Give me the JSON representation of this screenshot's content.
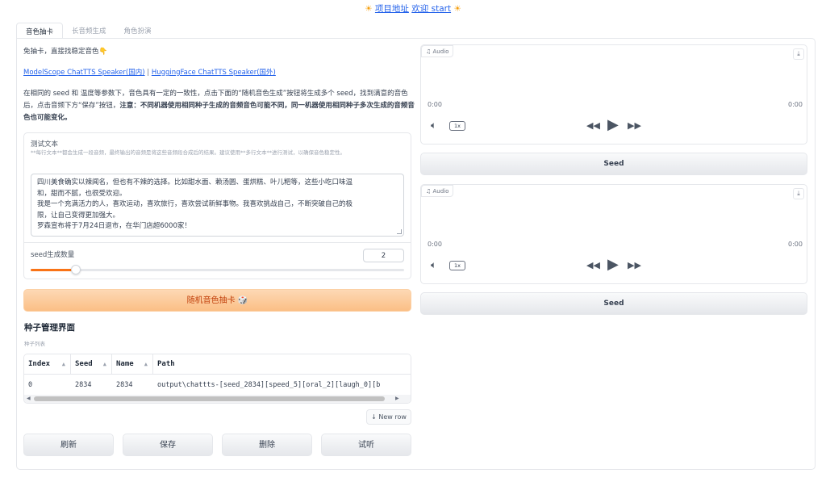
{
  "header": {
    "left_emoji": "☀",
    "link1": "项目地址",
    "link2": "欢迎 start",
    "right_emoji": "☀"
  },
  "tabs": [
    {
      "label": "音色抽卡",
      "active": true
    },
    {
      "label": "长音频生成",
      "active": false
    },
    {
      "label": "角色扮演",
      "active": false
    }
  ],
  "left": {
    "intro": "免抽卡，直接找稳定音色👇",
    "link_modelscope": "ModelScope ChatTTS Speaker(国内)",
    "link_sep": " | ",
    "link_hf": "HuggingFace ChatTTS Speaker(国外)",
    "desc_normal": "在相同的 seed 和 温度等参数下，音色具有一定的一致性，点击下面的“随机音色生成”按钮将生成多个 seed，找到满意的音色后，点击音频下方“保存”按钮，",
    "desc_bold": "注意：不同机器使用相同种子生成的音频音色可能不同，同一机器使用相同种子多次生成的音频音色也可能变化。",
    "test_text_label": "测试文本",
    "test_text_hint": "**每行文本**都会生成一段音频，最终输出的音频是将这些音频段合成后的结果。建议使用**多行文本**进行测试，以确保音色稳定性。",
    "test_text_lines": [
      "四川美食确实以辣闻名，但也有不辣的选择。比如甜水面、赖汤圆、蛋烘糕、叶儿粑等，这些小吃口味温",
      "和，甜而不腻，也很受欢迎。",
      "我是一个充满活力的人，喜欢运动，喜欢旅行，喜欢尝试新鲜事物。我喜欢挑战自己，不断突破自己的极",
      "限，让自己变得更加强大。",
      "罗森宣布将于7月24日退市，在华门店超6000家！"
    ],
    "seed_count_label": "seed生成数量",
    "seed_count_value": "2",
    "seed_slider_fraction": 0.12,
    "random_button": "随机音色抽卡 🎲",
    "seed_mgmt_title": "种子管理界面",
    "seed_list_label": "种子列表",
    "table": {
      "columns": [
        "Index",
        "Seed",
        "Name",
        "Path"
      ],
      "rows": [
        [
          "0",
          "2834",
          "2834",
          "output\\chattts-[seed_2834][speed_5][oral_2][laugh_0][b"
        ]
      ]
    },
    "new_row_button": "↓ New row",
    "buttons": [
      "刷新",
      "保存",
      "删除",
      "试听"
    ]
  },
  "right": {
    "audio_players": [
      {
        "tag": "Audio",
        "time_start": "0:00",
        "time_end": "0:00",
        "speed": "1x",
        "seed_button": "Seed"
      },
      {
        "tag": "Audio",
        "time_start": "0:00",
        "time_end": "0:00",
        "speed": "1x",
        "seed_button": "Seed"
      }
    ]
  },
  "colors": {
    "accent_orange": "#f97316",
    "link_blue": "#2563eb"
  }
}
